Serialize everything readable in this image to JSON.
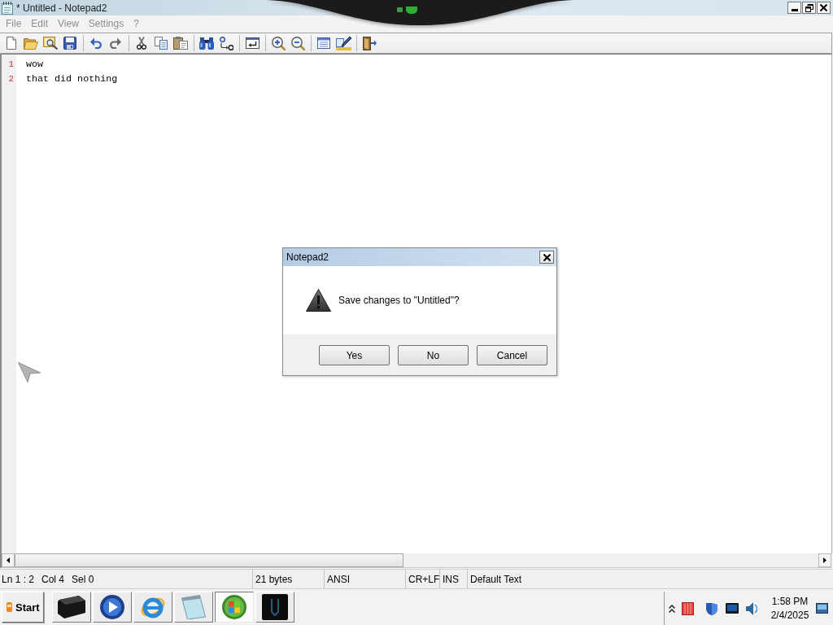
{
  "window": {
    "title": "* Untitled - Notepad2"
  },
  "menu": [
    {
      "label": "File",
      "disabled": true
    },
    {
      "label": "Edit",
      "disabled": true
    },
    {
      "label": "View",
      "disabled": true
    },
    {
      "label": "Settings",
      "disabled": true
    },
    {
      "label": "?",
      "disabled": true
    }
  ],
  "editor": {
    "lines": [
      {
        "number": "1",
        "text": "wow"
      },
      {
        "number": "2",
        "text": "that did nothing"
      }
    ]
  },
  "status_bar": {
    "panes": [
      {
        "texts": [
          "Ln 1 : 2",
          "Col 4",
          "Sel 0"
        ]
      },
      {
        "texts": [
          "21 bytes"
        ]
      },
      {
        "texts": [
          "ANSI"
        ]
      },
      {
        "texts": [
          "CR+LF"
        ]
      },
      {
        "texts": [
          "INS"
        ]
      },
      {
        "texts": [
          "Default Text"
        ]
      }
    ]
  },
  "dialog": {
    "title": "Notepad2",
    "message": "Save changes to \"Untitled\"?",
    "buttons": [
      "Yes",
      "No",
      "Cancel"
    ]
  },
  "taskbar": {
    "start": "Start",
    "buttons": [
      {
        "selected": false
      },
      {
        "selected": false
      },
      {
        "selected": false
      },
      {
        "selected": false
      },
      {
        "selected": true
      },
      {
        "selected": false
      }
    ],
    "clock": {
      "time": "1:58 PM",
      "date": "2/4/2025"
    }
  }
}
